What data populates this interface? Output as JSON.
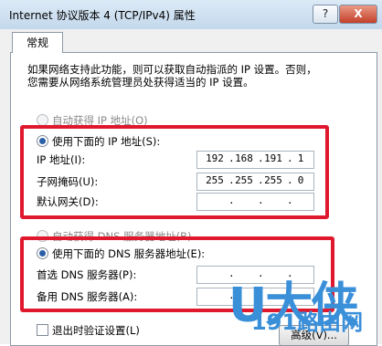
{
  "window": {
    "title": "Internet 协议版本 4 (TCP/IPv4) 属性",
    "help_label": "?",
    "close_label": "X"
  },
  "tabs": [
    {
      "label": "常规"
    }
  ],
  "description": {
    "line1": "如果网络支持此功能，则可以获取自动指派的 IP 设置。否则，",
    "line2": "您需要从网络系统管理员处获得适当的 IP 设置。"
  },
  "ip": {
    "auto_label": "自动获得 IP 地址(O)",
    "manual_label": "使用下面的 IP 地址(S):",
    "fields": [
      {
        "label": "IP 地址(I):",
        "octets": [
          "192",
          "168",
          "191",
          "1"
        ]
      },
      {
        "label": "子网掩码(U):",
        "octets": [
          "255",
          "255",
          "255",
          "0"
        ]
      },
      {
        "label": "默认网关(D):",
        "octets": [
          "",
          "",
          "",
          ""
        ]
      }
    ]
  },
  "dns": {
    "auto_label": "自动获得 DNS 服务器地址(B)",
    "manual_label": "使用下面的 DNS 服务器地址(E):",
    "fields": [
      {
        "label": "首选 DNS 服务器(P):",
        "octets": [
          "",
          "",
          "",
          ""
        ]
      },
      {
        "label": "备用 DNS 服务器(A):",
        "octets": [
          "",
          "",
          "",
          ""
        ]
      }
    ]
  },
  "validate_label": "退出时验证设置(L)",
  "advanced_label": "高级(V)...",
  "watermark": {
    "brand": "U大侠",
    "sub": "191路由网"
  },
  "colors": {
    "highlight_box": "#e0182d",
    "selected_radio": "#2a5fa8",
    "watermark": "#3a8fd9"
  }
}
